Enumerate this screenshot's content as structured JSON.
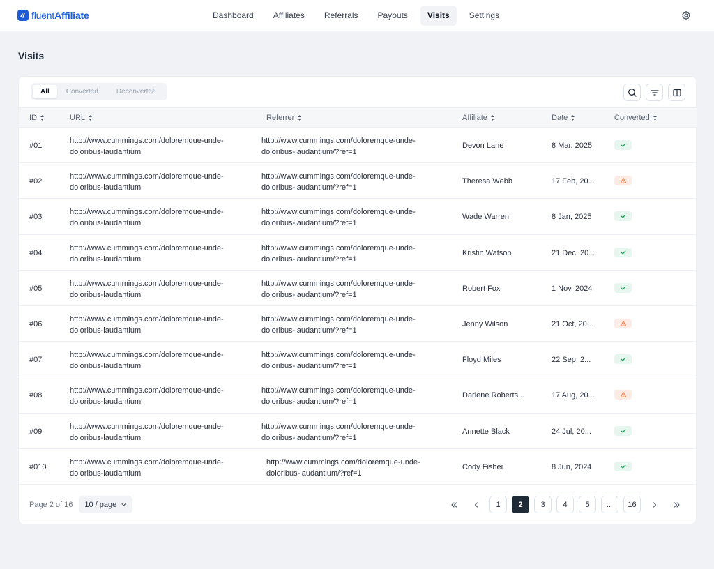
{
  "brand": {
    "name_light": "fluent",
    "name_bold": "Affiliate",
    "accent": "#1e5bd8"
  },
  "nav": [
    {
      "label": "Dashboard"
    },
    {
      "label": "Affiliates"
    },
    {
      "label": "Referrals"
    },
    {
      "label": "Payouts"
    },
    {
      "label": "Visits",
      "active": true
    },
    {
      "label": "Settings"
    }
  ],
  "page_title": "Visits",
  "filters": [
    {
      "label": "All",
      "active": true
    },
    {
      "label": "Converted"
    },
    {
      "label": "Deconverted"
    }
  ],
  "toolbar": {
    "search_icon": "search-icon",
    "filter_icon": "filter-icon",
    "columns_icon": "columns-icon"
  },
  "table": {
    "columns": [
      "ID",
      "URL",
      "Referrer",
      "Affiliate",
      "Date",
      "Converted"
    ],
    "rows": [
      {
        "id": "#01",
        "url": "http://www.cummings.com/doloremque-unde-doloribus-laudantium",
        "referrer": "http://www.cummings.com/doloremque-unde-doloribus-laudantium/?ref=1",
        "affiliate": "Devon Lane",
        "date": "8 Mar, 2025",
        "converted": "ok"
      },
      {
        "id": "#02",
        "url": "http://www.cummings.com/doloremque-unde-doloribus-laudantium",
        "referrer": "http://www.cummings.com/doloremque-unde-doloribus-laudantium/?ref=1",
        "affiliate": "Theresa Webb",
        "date": "17 Feb, 20...",
        "converted": "warn"
      },
      {
        "id": "#03",
        "url": "http://www.cummings.com/doloremque-unde-doloribus-laudantium",
        "referrer": "http://www.cummings.com/doloremque-unde-doloribus-laudantium/?ref=1",
        "affiliate": "Wade Warren",
        "date": "8 Jan, 2025",
        "converted": "ok"
      },
      {
        "id": "#04",
        "url": "http://www.cummings.com/doloremque-unde-doloribus-laudantium",
        "referrer": "http://www.cummings.com/doloremque-unde-doloribus-laudantium/?ref=1",
        "affiliate": "Kristin Watson",
        "date": "21 Dec, 20...",
        "converted": "ok"
      },
      {
        "id": "#05",
        "url": "http://www.cummings.com/doloremque-unde-doloribus-laudantium",
        "referrer": "http://www.cummings.com/doloremque-unde-doloribus-laudantium/?ref=1",
        "affiliate": "Robert Fox",
        "date": "1 Nov, 2024",
        "converted": "ok"
      },
      {
        "id": "#06",
        "url": "http://www.cummings.com/doloremque-unde-doloribus-laudantium",
        "referrer": "http://www.cummings.com/doloremque-unde-doloribus-laudantium/?ref=1",
        "affiliate": "Jenny Wilson",
        "date": "21 Oct, 20...",
        "converted": "warn"
      },
      {
        "id": "#07",
        "url": "http://www.cummings.com/doloremque-unde-doloribus-laudantium",
        "referrer": "http://www.cummings.com/doloremque-unde-doloribus-laudantium/?ref=1",
        "affiliate": "Floyd Miles",
        "date": "22 Sep, 2...",
        "converted": "ok"
      },
      {
        "id": "#08",
        "url": "http://www.cummings.com/doloremque-unde-doloribus-laudantium",
        "referrer": "http://www.cummings.com/doloremque-unde-doloribus-laudantium/?ref=1",
        "affiliate": "Darlene Roberts...",
        "date": "17 Aug, 20...",
        "converted": "warn"
      },
      {
        "id": "#09",
        "url": "http://www.cummings.com/doloremque-unde-doloribus-laudantium",
        "referrer": "http://www.cummings.com/doloremque-unde-doloribus-laudantium/?ref=1",
        "affiliate": "Annette Black",
        "date": "24 Jul, 20...",
        "converted": "ok"
      },
      {
        "id": "#010",
        "url": "http://www.cummings.com/doloremque-unde-doloribus-laudantium",
        "referrer": "http://www.cummings.com/doloremque-unde-doloribus-laudantium/?ref=1",
        "affiliate": "Cody Fisher",
        "date": "8 Jun, 2024",
        "converted": "ok"
      }
    ]
  },
  "pagination": {
    "info": "Page 2 of 16",
    "per_page": "10 / page",
    "pages": [
      "1",
      "2",
      "3",
      "4",
      "5",
      "...",
      "16"
    ],
    "current": "2"
  },
  "colors": {
    "ok": "#22a05a",
    "warn": "#f07a4a",
    "active_page": "#1f2a37"
  }
}
